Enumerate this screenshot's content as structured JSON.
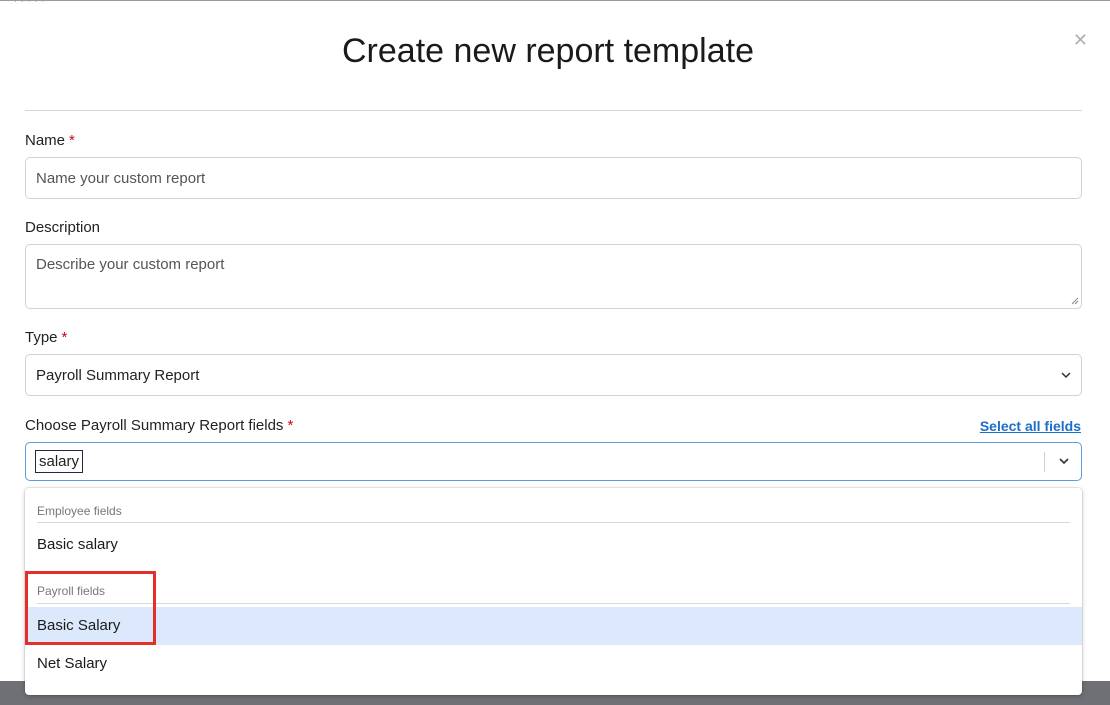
{
  "modal": {
    "title": "Create new report template",
    "close_icon": "close-icon",
    "drag_handle": "· · · · ·"
  },
  "form": {
    "name": {
      "label": "Name",
      "required_mark": "*",
      "placeholder": "Name your custom report",
      "value": ""
    },
    "description": {
      "label": "Description",
      "placeholder": "Describe your custom report",
      "value": ""
    },
    "type": {
      "label": "Type",
      "required_mark": "*",
      "selected": "Payroll Summary Report",
      "icon": "chevron-down-icon"
    },
    "fields": {
      "label": "Choose Payroll Summary Report fields",
      "required_mark": "*",
      "select_all_label": "Select all fields",
      "search_value": "salary",
      "icon": "chevron-down-icon"
    }
  },
  "dropdown": {
    "groups": [
      {
        "header": "Employee fields",
        "options": [
          {
            "label": "Basic salary",
            "active": false
          }
        ]
      },
      {
        "header": "Payroll fields",
        "options": [
          {
            "label": "Basic Salary",
            "active": true
          },
          {
            "label": "Net Salary",
            "active": false
          }
        ]
      }
    ]
  },
  "colors": {
    "required": "#d0021b",
    "link": "#1a6fc9",
    "focus_border": "#5b9be0",
    "active_option_bg": "#dce9fd",
    "annotation_red": "#e4302b"
  }
}
